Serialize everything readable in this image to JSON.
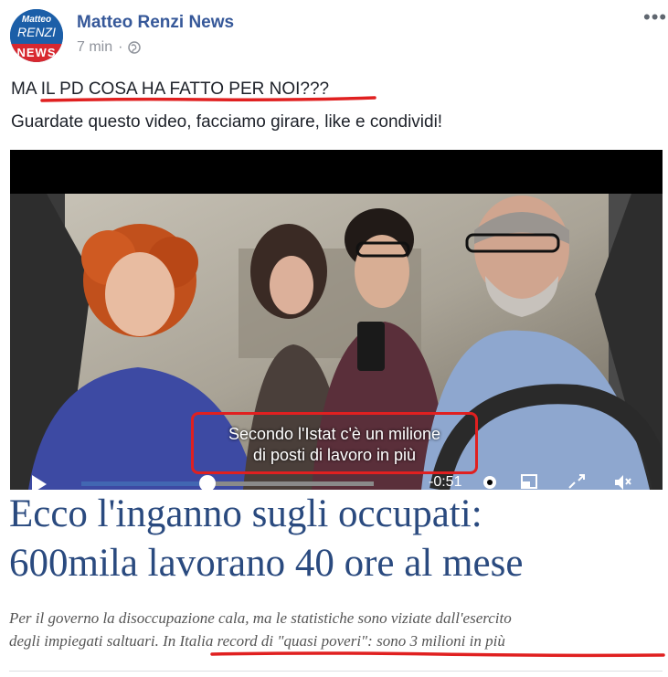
{
  "post": {
    "page_name": "Matteo Renzi News",
    "time": "7 min",
    "text_line1": "MA IL PD COSA HA FATTO PER NOI???",
    "text_line2": "Guardate questo video, facciamo girare, like e condividi!"
  },
  "avatar": {
    "line1": "Matteo",
    "line2": "RENZI",
    "line3": "NEWS"
  },
  "video": {
    "subtitle_line1": "Secondo l'Istat c'è un milione",
    "subtitle_line2": "di posti di lavoro in più",
    "time": "-0:51",
    "progress": 0.43
  },
  "article": {
    "headline_line1": "Ecco l'inganno sugli occupati:",
    "headline_line2": "600mila lavorano 40 ore al mese",
    "standfirst_line1": "Per il governo la disoccupazione cala, ma le statistiche sono viziate dall'esercito",
    "standfirst_line2": "degli impiegati saltuari. In Italia record di \"quasi poveri\": sono 3 milioni in più"
  },
  "colors": {
    "link": "#365899",
    "headline": "#2a4a7f",
    "annotation": "#e02020"
  },
  "icons": [
    "globe-icon",
    "more-options-icon",
    "play-icon",
    "settings-icon",
    "popout-icon",
    "fullscreen-icon",
    "volume-muted-icon"
  ]
}
